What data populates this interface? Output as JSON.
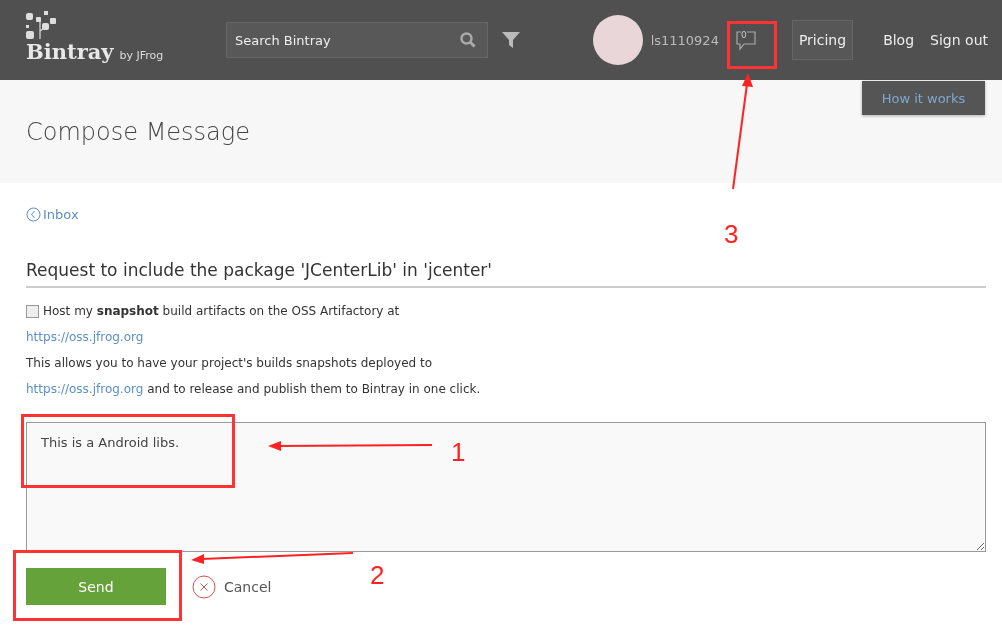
{
  "header": {
    "logo": "Bintray",
    "logo_suffix": "by JFrog",
    "search": {
      "placeholder": "Search Bintray"
    },
    "username": "ls1110924",
    "message_count": "0",
    "nav": [
      {
        "label": "Pricing",
        "selected": true
      },
      {
        "label": "Blog",
        "selected": false
      },
      {
        "label": "Sign out",
        "selected": false
      }
    ],
    "how_it_works": "How it works"
  },
  "page_title": "Compose Message",
  "back_link": "Inbox",
  "subject": "Request to include the package 'JCenterLib' in 'jcenter'",
  "snapshot": {
    "checked": false,
    "label": "Host my **snapshot** build artifacts on the OSS Artifactory at",
    "link": "https://oss.jfrog.org",
    "note": "This allows you to have your project's builds snapshots deployed to",
    "link2": "https://oss.jfrog.org",
    "note2": "and to release and publish them to Bintray in one click."
  },
  "message": "This is a Android libs.",
  "buttons": {
    "send": "Send",
    "cancel": "Cancel"
  },
  "annotations": [
    "1",
    "2",
    "3"
  ]
}
